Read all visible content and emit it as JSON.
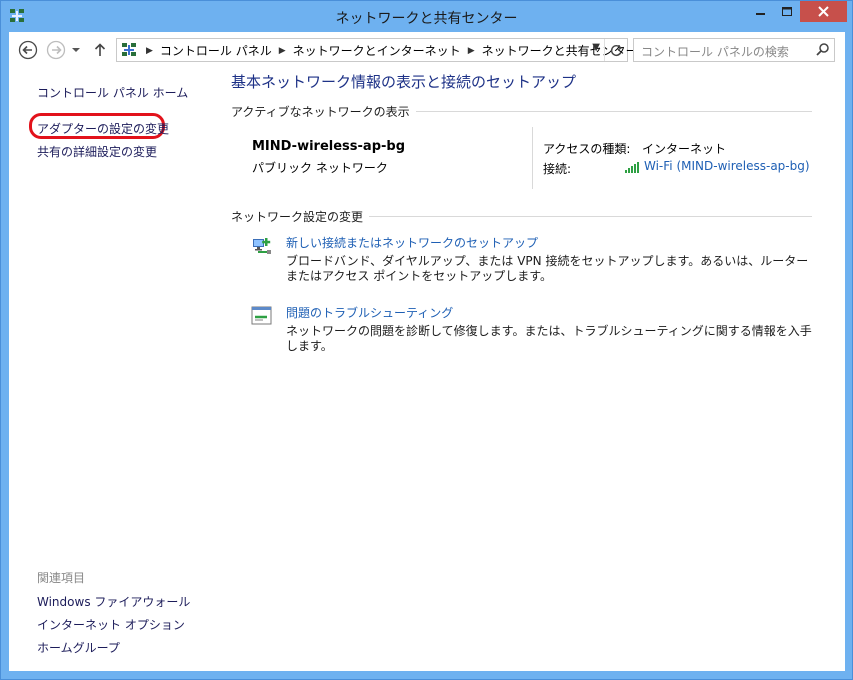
{
  "window": {
    "title": "ネットワークと共有センター"
  },
  "address": {
    "crumbs": [
      "コントロール パネル",
      "ネットワークとインターネット",
      "ネットワークと共有センター"
    ]
  },
  "search": {
    "placeholder": "コントロール パネルの検索"
  },
  "sidebar": {
    "home": "コントロール パネル ホーム",
    "adapter": "アダプターの設定の変更",
    "advanced": "共有の詳細設定の変更",
    "related_title": "関連項目",
    "related": [
      "Windows ファイアウォール",
      "インターネット オプション",
      "ホームグループ"
    ]
  },
  "main": {
    "title": "基本ネットワーク情報の表示と接続のセットアップ",
    "active_section": "アクティブなネットワークの表示",
    "network_name": "MIND-wireless-ap-bg",
    "network_type": "パブリック ネットワーク",
    "access_type_label": "アクセスの種類:",
    "access_type_value": "インターネット",
    "connection_label": "接続:",
    "connection_value": "Wi-Fi (MIND-wireless-ap-bg)",
    "change_section": "ネットワーク設定の変更",
    "tasks": [
      {
        "link": "新しい接続またはネットワークのセットアップ",
        "desc": "ブロードバンド、ダイヤルアップ、または VPN 接続をセットアップします。あるいは、ルーターまたはアクセス ポイントをセットアップします。"
      },
      {
        "link": "問題のトラブルシューティング",
        "desc": "ネットワークの問題を診断して修復します。または、トラブルシューティングに関する情報を入手します。"
      }
    ]
  },
  "colors": {
    "titlebar": "#6eb1f0",
    "close": "#c7504b",
    "highlight": "#e2121b",
    "link": "#1e5fb4",
    "heading": "#1e3287"
  }
}
